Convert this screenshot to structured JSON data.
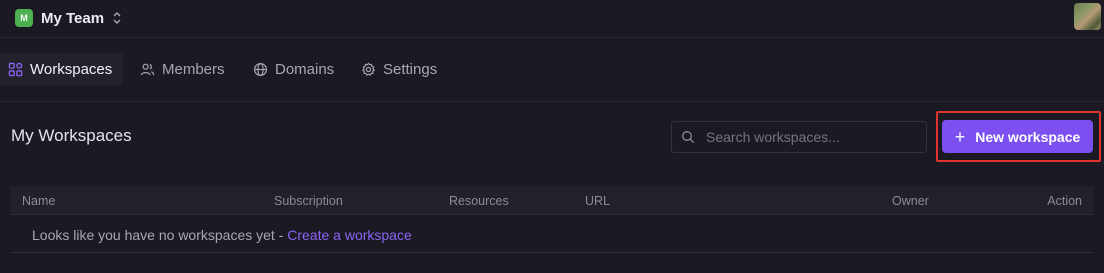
{
  "team": {
    "badge": "M",
    "name": "My Team",
    "badge_color": "#4caf50"
  },
  "tabs": [
    {
      "label": "Workspaces",
      "icon": "grid-icon",
      "active": true
    },
    {
      "label": "Members",
      "icon": "users-icon",
      "active": false
    },
    {
      "label": "Domains",
      "icon": "globe-icon",
      "active": false
    },
    {
      "label": "Settings",
      "icon": "gear-icon",
      "active": false
    }
  ],
  "main": {
    "title": "My Workspaces",
    "search_placeholder": "Search workspaces...",
    "new_button_label": "New workspace",
    "accent_color": "#7b4ff0",
    "highlight_color": "#e0322f"
  },
  "table": {
    "columns": [
      "Name",
      "Subscription",
      "Resources",
      "URL",
      "Owner",
      "Action"
    ],
    "empty_text": "Looks like you have no workspaces yet - ",
    "empty_link": "Create a workspace"
  }
}
